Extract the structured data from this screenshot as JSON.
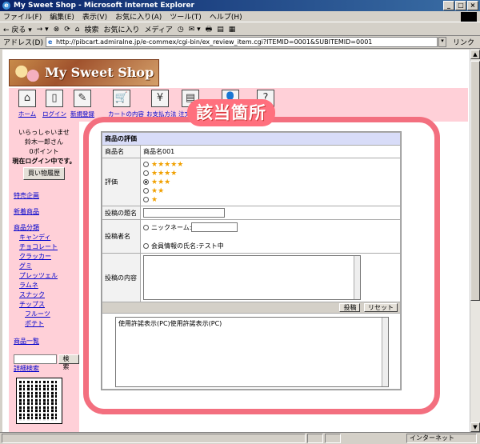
{
  "window": {
    "title": "My Sweet Shop - Microsoft Internet Explorer",
    "buttons": [
      "_",
      "□",
      "×"
    ]
  },
  "menu": [
    "ファイル(F)",
    "編集(E)",
    "表示(V)",
    "お気に入り(A)",
    "ツール(T)",
    "ヘルプ(H)"
  ],
  "toolbar": [
    "← 戻る ▾",
    "→ ▾",
    "⊗",
    "⟳",
    "⌂",
    "検索",
    "お気に入り",
    "メディア",
    "◷",
    "✉ ▾",
    "🖶",
    "▤",
    "▦"
  ],
  "address": {
    "label": "アドレス(D)",
    "url": "http://pibcart.admiralne.jp/e-commex/cgi-bin/ex_review_item.cgi?ITEMID=0001&SUBITEMID=0001",
    "go": "▾",
    "links": "リンク"
  },
  "page": {
    "logo_text": "My Sweet Shop",
    "nav": [
      {
        "label": "ホーム",
        "icon": "house-icon",
        "glyph": "⌂"
      },
      {
        "label": "ログイン",
        "icon": "door-icon",
        "glyph": "▯"
      },
      {
        "label": "新規登録",
        "icon": "pen-icon",
        "glyph": "✎"
      },
      {
        "label": "カートの内容",
        "icon": "cart-icon",
        "glyph": "🛒"
      },
      {
        "label": "お支払方法",
        "icon": "yen-icon",
        "glyph": "¥"
      },
      {
        "label": "注文履歴",
        "icon": "document-icon",
        "glyph": "▤"
      },
      {
        "label": "",
        "icon": "person-icon",
        "glyph": "👤"
      },
      {
        "label": "",
        "icon": "help-icon",
        "glyph": "?"
      }
    ],
    "sidebar": {
      "welcome": "いらっしゃいませ",
      "user_name": "鈴木一郎さん",
      "points": "0ポイント",
      "login_status": "現在ログイン中です。",
      "cart_button": "買い物履歴",
      "links": {
        "special": "特売企画",
        "new": "新着商品",
        "category": "商品分類",
        "candy": "キャンディ",
        "chocolate": "チョコレート",
        "cracker": "クラッカー",
        "gum": "グミ",
        "pretzel": "プレッツェル",
        "ramune": "ラムネ",
        "snack": "スナック",
        "chips": "チップス",
        "fruits": "フルーツ",
        "potato": "ポテト",
        "list": "商品一覧",
        "advanced": "詳細検索"
      },
      "search_button": "検索"
    },
    "review_form": {
      "heading": "商品の評価",
      "product_label": "商品名",
      "product_value": "商品名001",
      "rating_label": "評価",
      "ratings": [
        {
          "stars": "★★★★★",
          "checked": false
        },
        {
          "stars": "★★★★",
          "checked": false
        },
        {
          "stars": "★★★",
          "checked": true
        },
        {
          "stars": "★★",
          "checked": false
        },
        {
          "stars": "★",
          "checked": false
        }
      ],
      "title_label": "投稿の題名",
      "author_label": "投稿者名",
      "nickname_option": "ニックネーム:",
      "member_option": "会員情報の氏名:テスト中",
      "content_label": "投稿の内容",
      "submit_button": "投稿",
      "reset_button": "リセット",
      "license_text": "使用許諾表示(PC)使用許諾表示(PC)"
    },
    "callout": "該当箇所",
    "accent_color": "#f36f7f"
  },
  "status": {
    "zone": "インターネット"
  }
}
